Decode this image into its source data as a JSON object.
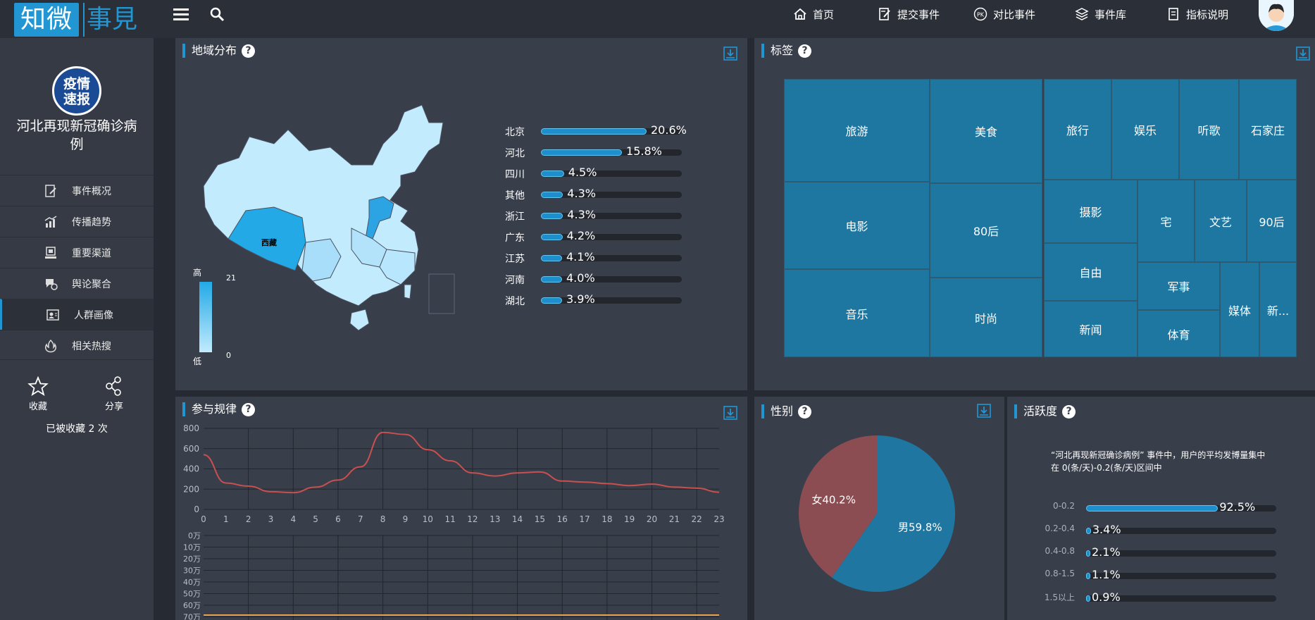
{
  "brand": {
    "logo_left": "知微",
    "logo_right": "事見"
  },
  "nav": [
    {
      "label": "首页",
      "icon": "home-icon"
    },
    {
      "label": "提交事件",
      "icon": "submit-icon"
    },
    {
      "label": "对比事件",
      "icon": "pk-icon"
    },
    {
      "label": "事件库",
      "icon": "layers-icon"
    },
    {
      "label": "指标说明",
      "icon": "document-icon"
    }
  ],
  "sidebar": {
    "badge_line1": "疫情",
    "badge_line2": "速报",
    "event_title": "河北再现新冠确诊病例",
    "items": [
      {
        "label": "事件概况",
        "icon": "overview-icon"
      },
      {
        "label": "传播趋势",
        "icon": "trend-icon"
      },
      {
        "label": "重要渠道",
        "icon": "channel-icon"
      },
      {
        "label": "舆论聚合",
        "icon": "opinion-icon"
      },
      {
        "label": "人群画像",
        "icon": "portrait-icon",
        "active": true
      },
      {
        "label": "相关热搜",
        "icon": "fire-icon"
      }
    ],
    "favorite_label": "收藏",
    "share_label": "分享",
    "favorite_count": "已被收藏 2 次"
  },
  "region": {
    "title": "地域分布",
    "legend_high": "高",
    "legend_low": "低",
    "legend_max": "21",
    "legend_min": "0",
    "map_label": "西藏",
    "rows": [
      {
        "name": "北京",
        "pct": "20.6%",
        "value": 20.6
      },
      {
        "name": "河北",
        "pct": "15.8%",
        "value": 15.8
      },
      {
        "name": "四川",
        "pct": "4.5%",
        "value": 4.5
      },
      {
        "name": "其他",
        "pct": "4.3%",
        "value": 4.3
      },
      {
        "name": "浙江",
        "pct": "4.3%",
        "value": 4.3
      },
      {
        "name": "广东",
        "pct": "4.2%",
        "value": 4.2
      },
      {
        "name": "江苏",
        "pct": "4.1%",
        "value": 4.1
      },
      {
        "name": "河南",
        "pct": "4.0%",
        "value": 4.0
      },
      {
        "name": "湖北",
        "pct": "3.9%",
        "value": 3.9
      }
    ]
  },
  "tags": {
    "title": "标签",
    "items": [
      "旅游",
      "美食",
      "旅行",
      "娱乐",
      "听歌",
      "石家庄",
      "电影",
      "80后",
      "摄影",
      "宅",
      "文艺",
      "90后",
      "自由",
      "军事",
      "媒体",
      "新...",
      "音乐",
      "时尚",
      "新闻",
      "体育"
    ]
  },
  "rhythm": {
    "title": "参与规律",
    "y_ticks": [
      "800",
      "600",
      "400",
      "200",
      "0"
    ],
    "x_ticks": [
      "0",
      "1",
      "2",
      "3",
      "4",
      "5",
      "6",
      "7",
      "8",
      "9",
      "10",
      "11",
      "12",
      "13",
      "14",
      "15",
      "16",
      "17",
      "18",
      "19",
      "20",
      "21",
      "22",
      "23"
    ],
    "y2_ticks": [
      "0万",
      "10万",
      "20万",
      "30万",
      "40万",
      "50万",
      "60万",
      "70万"
    ]
  },
  "gender": {
    "title": "性别",
    "male_label": "男59.8%",
    "female_label": "女40.2%"
  },
  "activity": {
    "title": "活跃度",
    "desc_line1": "“河北再现新冠确诊病例” 事件中，用户的平均发博量集中",
    "desc_line2": "在 0(条/天)-0.2(条/天)区间中",
    "rows": [
      {
        "name": "0-0.2",
        "pct": "92.5%",
        "value": 92.5
      },
      {
        "name": "0.2-0.4",
        "pct": "3.4%",
        "value": 3.4
      },
      {
        "name": "0.4-0.8",
        "pct": "2.1%",
        "value": 2.1
      },
      {
        "name": "0.8-1.5",
        "pct": "1.1%",
        "value": 1.1
      },
      {
        "name": "1.5以上",
        "pct": "0.9%",
        "value": 0.9
      }
    ]
  },
  "chart_data": [
    {
      "type": "line",
      "x": [
        0,
        1,
        2,
        3,
        4,
        5,
        6,
        7,
        8,
        9,
        10,
        11,
        12,
        13,
        14,
        15,
        16,
        17,
        18,
        19,
        20,
        21,
        22,
        23
      ],
      "series": [
        {
          "values": [
            540,
            260,
            230,
            175,
            165,
            220,
            290,
            420,
            760,
            740,
            590,
            480,
            360,
            330,
            360,
            370,
            280,
            270,
            255,
            235,
            250,
            220,
            210,
            170
          ]
        }
      ],
      "ylim": [
        0,
        800
      ],
      "grid": true
    },
    {
      "type": "pie",
      "slices": [
        {
          "label": "男59.8%",
          "value": 59.8,
          "color": "#1f77a1"
        },
        {
          "label": "女40.2%",
          "value": 40.2,
          "color": "#8c4d52"
        }
      ]
    },
    {
      "type": "bar",
      "categories": [
        "北京",
        "河北",
        "四川",
        "其他",
        "浙江",
        "广东",
        "江苏",
        "河南",
        "湖北"
      ],
      "values": [
        20.6,
        15.8,
        4.5,
        4.3,
        4.3,
        4.2,
        4.1,
        4.0,
        3.9
      ]
    },
    {
      "type": "bar",
      "categories": [
        "0-0.2",
        "0.2-0.4",
        "0.4-0.8",
        "0.8-1.5",
        "1.5以上"
      ],
      "values": [
        92.5,
        3.4,
        2.1,
        1.1,
        0.9
      ]
    }
  ]
}
